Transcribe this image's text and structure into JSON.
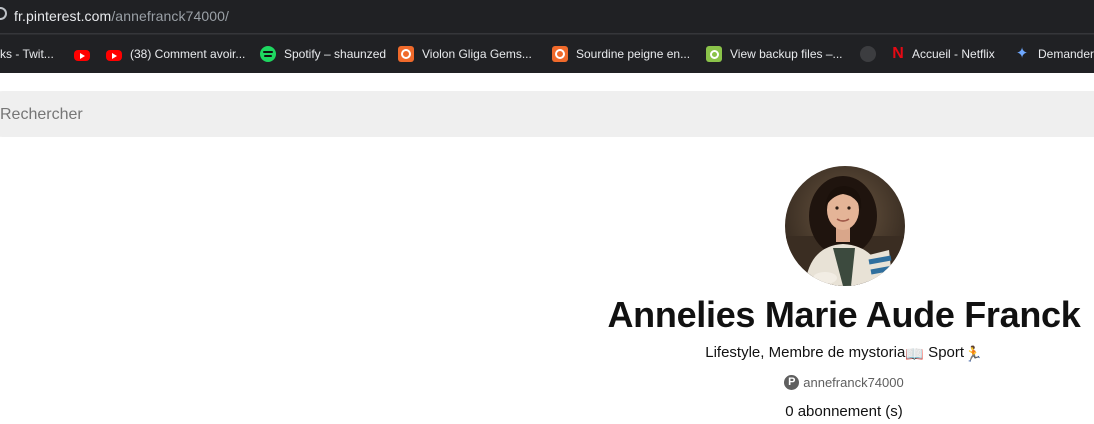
{
  "browser": {
    "url_host": "fr.pinterest.com",
    "url_path": "/annefranck74000/"
  },
  "bookmarks": [
    {
      "label": "rks - Twit...",
      "icon": "none"
    },
    {
      "label": "",
      "icon": "youtube-icon"
    },
    {
      "label": "(38) Comment avoir...",
      "icon": "youtube-icon"
    },
    {
      "label": "Spotify – shaunzed",
      "icon": "spotify-icon"
    },
    {
      "label": "Violon Gliga Gems...",
      "icon": "swirl-icon"
    },
    {
      "label": "Sourdine peigne en...",
      "icon": "swirl-icon"
    },
    {
      "label": "View backup files –...",
      "icon": "backup-icon"
    },
    {
      "label": "",
      "icon": "github-icon"
    },
    {
      "label": "Accueil - Netflix",
      "icon": "netflix-icon"
    },
    {
      "label": "Demander",
      "icon": "ai-icon"
    }
  ],
  "search": {
    "placeholder": "Rechercher"
  },
  "profile": {
    "name": "Annelies Marie Aude Franck",
    "bio_text": "Lifestyle, Membre de mystoria",
    "bio_emoji_1": "📖",
    "bio_text_2": " Sport",
    "bio_emoji_2": "🏃",
    "handle": "annefranck74000",
    "following": "0 abonnement (s)"
  },
  "colors": {
    "toolbar_bg": "#202124",
    "search_bg": "#efefef",
    "text": "#111111",
    "muted": "#5f5f5f"
  }
}
